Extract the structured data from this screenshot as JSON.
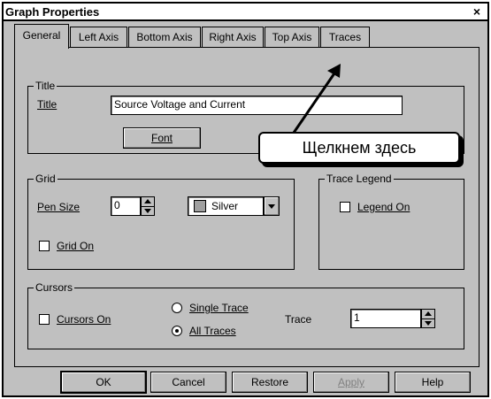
{
  "dialog": {
    "title": "Graph Properties",
    "close": "×"
  },
  "tabs": [
    {
      "label": "General"
    },
    {
      "label": "Left Axis"
    },
    {
      "label": "Bottom Axis"
    },
    {
      "label": "Right Axis"
    },
    {
      "label": "Top Axis"
    },
    {
      "label": "Traces"
    }
  ],
  "title_group": {
    "legend": "Title",
    "title_label": "Title",
    "title_value": "Source Voltage and Current",
    "font_button": "Font"
  },
  "callout": {
    "text": "Щелкнем здесь"
  },
  "grid_group": {
    "legend": "Grid",
    "pen_size_label": "Pen Size",
    "pen_size_value": "0",
    "color_value": "Silver",
    "grid_on_label": "Grid On"
  },
  "trace_legend_group": {
    "legend": "Trace Legend",
    "legend_on_label": "Legend On"
  },
  "cursors_group": {
    "legend": "Cursors",
    "cursors_on_label": "Cursors On",
    "single_trace_label": "Single Trace",
    "all_traces_label": "All Traces",
    "trace_label": "Trace",
    "trace_value": "1"
  },
  "buttons": {
    "ok": "OK",
    "cancel": "Cancel",
    "restore": "Restore",
    "apply": "Apply",
    "help": "Help"
  },
  "colors": {
    "dialog_bg": "#c0c0c0",
    "silver_swatch": "#a0a0a0"
  }
}
